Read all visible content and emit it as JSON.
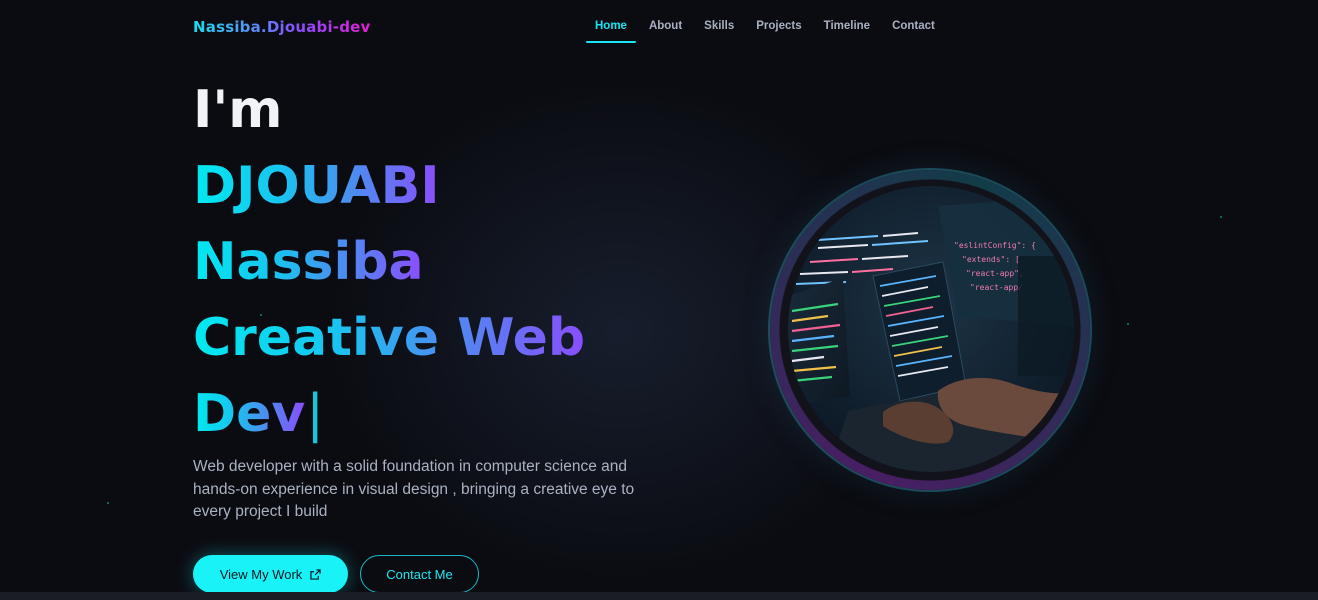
{
  "nav": {
    "brand": "Nassiba.Djouabi-dev",
    "links": [
      {
        "label": "Home",
        "active": true
      },
      {
        "label": "About",
        "active": false
      },
      {
        "label": "Skills",
        "active": false
      },
      {
        "label": "Projects",
        "active": false
      },
      {
        "label": "Timeline",
        "active": false
      },
      {
        "label": "Contact",
        "active": false
      }
    ]
  },
  "hero": {
    "greeting": "I'm",
    "last_name": "DJOUABI",
    "first_name": "Nassiba",
    "typed_line1": "Creative Web",
    "typed_line2": "Dev",
    "cursor": "|",
    "description": "Web developer with a solid foundation in computer science and hands-on experience in visual design , bringing a creative eye to every project I build",
    "primary_button": "View My Work",
    "secondary_button": "Contact Me"
  },
  "colors": {
    "background": "#0b0c12",
    "accent": "#19f2f6",
    "gradient_start": "#00eaf0",
    "gradient_end": "#8a4dff",
    "muted_text": "#aab2c2"
  },
  "icons": {
    "primary_button_icon": "external-link-icon",
    "scroll_icon": "chevron-down-icon"
  }
}
